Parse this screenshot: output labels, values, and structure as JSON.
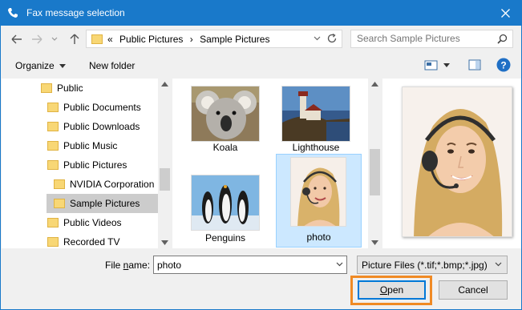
{
  "window": {
    "title": "Fax message selection"
  },
  "address": {
    "overflow": "«",
    "crumbs": [
      "Public Pictures",
      "Sample Pictures"
    ]
  },
  "search": {
    "placeholder": "Search Sample Pictures"
  },
  "toolbar": {
    "organize_label": "Organize",
    "new_folder_label": "New folder"
  },
  "tree": {
    "items": [
      {
        "label": "Public",
        "indent": 1
      },
      {
        "label": "Public Documents",
        "indent": 2
      },
      {
        "label": "Public Downloads",
        "indent": 2
      },
      {
        "label": "Public Music",
        "indent": 2
      },
      {
        "label": "Public Pictures",
        "indent": 2
      },
      {
        "label": "NVIDIA Corporation",
        "indent": 3
      },
      {
        "label": "Sample Pictures",
        "indent": 3,
        "selected": true
      },
      {
        "label": "Public Videos",
        "indent": 2
      },
      {
        "label": "Recorded TV",
        "indent": 2
      }
    ]
  },
  "files": {
    "items": [
      {
        "name": "Koala"
      },
      {
        "name": "Lighthouse"
      },
      {
        "name": "Penguins"
      },
      {
        "name": "photo",
        "selected": true
      }
    ]
  },
  "filename": {
    "label": "File name:",
    "label_prefix": "File ",
    "label_accel": "n",
    "label_suffix": "ame:",
    "value": "photo"
  },
  "filter": {
    "value": "Picture Files (*.tif;*.bmp;*.jpg)"
  },
  "buttons": {
    "open_accel": "O",
    "open_rest": "pen",
    "open_label": "Open",
    "cancel_label": "Cancel"
  },
  "colors": {
    "titlebar": "#1979ca",
    "selection": "#cce8ff",
    "highlight_ring": "#f08a24",
    "default_button_border": "#0078d7"
  }
}
